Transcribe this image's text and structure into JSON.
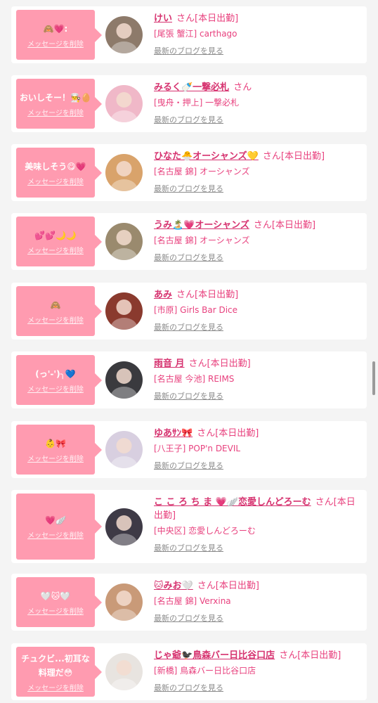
{
  "list": {
    "delete_label": "メッセージを削除",
    "blog_label": "最新のブログを見る",
    "san": "さん",
    "items": [
      {
        "message": "🙈💗:",
        "name": "けい",
        "status": "[本日出勤]",
        "shop": "[尾張 蟹江] carthago",
        "avatar_color": "#8d7a6a"
      },
      {
        "message": "おいしそー！👨‍🍳🥚",
        "name": "みるく🍼一撃必札",
        "status": "",
        "shop": "[曳舟・押上] 一撃必札",
        "avatar_color": "#f0b8c8"
      },
      {
        "message": "美味しそう😋💗",
        "name": "ひなた🐣オーシャンズ💛",
        "status": "[本日出勤]",
        "shop": "[名古屋 錦] オーシャンズ",
        "avatar_color": "#d9a36b"
      },
      {
        "message": "💕💕🌙🌙",
        "name": "うみ🏝️💗オーシャンズ",
        "status": "[本日出勤]",
        "shop": "[名古屋 錦] オーシャンズ",
        "avatar_color": "#9a8a6e"
      },
      {
        "message": "🙈",
        "name": "あみ",
        "status": "[本日出勤]",
        "shop": "[市原] Girls Bar Dice",
        "avatar_color": "#8a3a2e"
      },
      {
        "message": "(っ'-')╮💙",
        "name": "雨音 月",
        "status": "[本日出勤]",
        "shop": "[名古屋 今池] REIMS",
        "avatar_color": "#3a3a3e"
      },
      {
        "message": "👶🎀",
        "name": "ゆあｻﾝ🎀",
        "status": "[本日出勤]",
        "shop": "[八王子] POP'n DEVIL",
        "avatar_color": "#d8cfe0"
      },
      {
        "message": "💗🪽",
        "name": "こ こ ろ ち ま 💗🪽恋愛しんどろーむ",
        "status": "[本日出勤]",
        "shop": "[中央区] 恋愛しんどろーむ",
        "avatar_color": "#3e3a46"
      },
      {
        "message": "🤍🐱🤍",
        "name": "🐱みお🤍",
        "status": "[本日出勤]",
        "shop": "[名古屋 錦] Verxina",
        "avatar_color": "#c99a78"
      },
      {
        "message": "チュクビ...初耳な料理だ😳",
        "name": "じゃ爺🐦‍⬛鳥森バー日比谷口店",
        "status": "[本日出勤]",
        "shop": "[新橋] 鳥森バー日比谷口店",
        "avatar_color": "#e8e4e0"
      }
    ]
  }
}
